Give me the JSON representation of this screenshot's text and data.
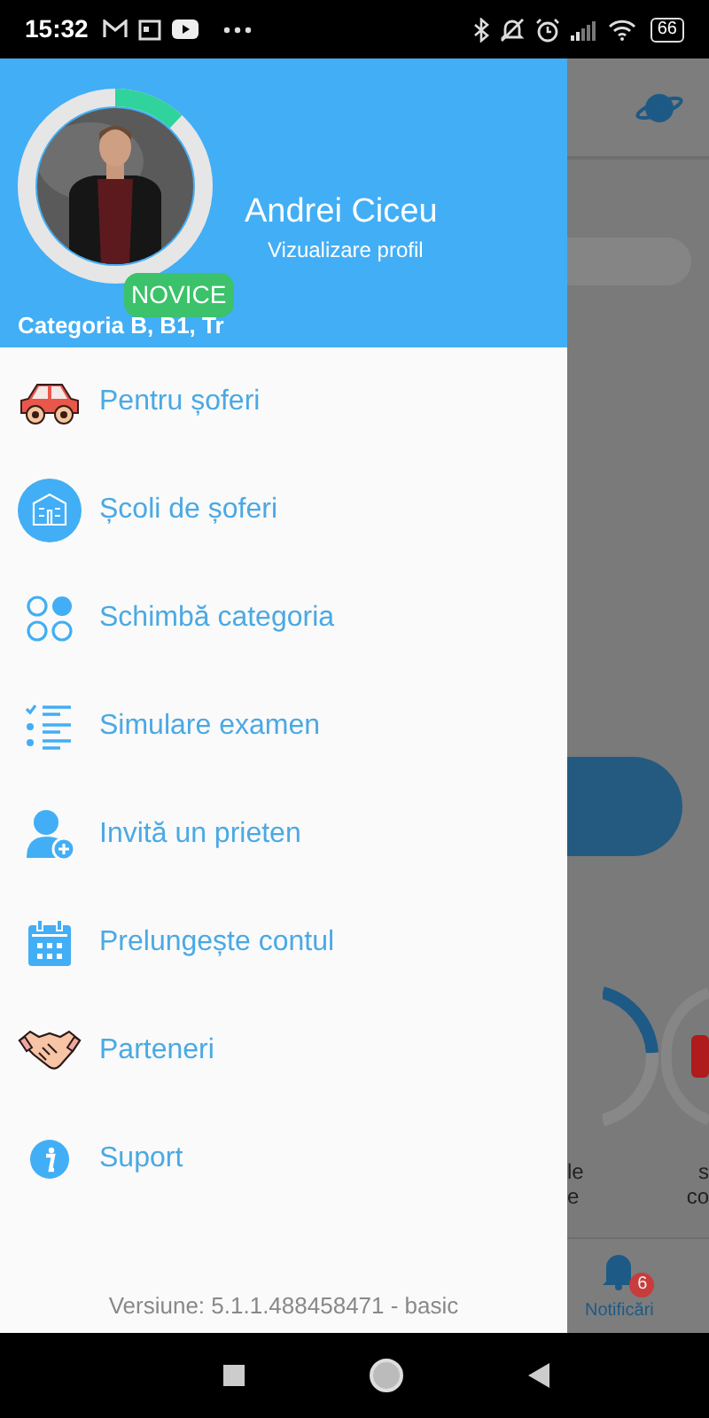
{
  "status_bar": {
    "time": "15:32",
    "battery": "66"
  },
  "profile": {
    "name": "Andrei Ciceu",
    "link": "Vizualizare profil",
    "badge": "NOVICE",
    "category": "Categoria B, B1, Tr"
  },
  "menu": [
    {
      "label": "Pentru șoferi",
      "kind": "car"
    },
    {
      "label": "Școli de șoferi",
      "kind": "school"
    },
    {
      "label": "Schimbă categoria",
      "kind": "dots"
    },
    {
      "label": "Simulare examen",
      "kind": "checklist"
    },
    {
      "label": "Invită un prieten",
      "kind": "user-add"
    },
    {
      "label": "Prelungește contul",
      "kind": "calendar"
    },
    {
      "label": "Parteneri",
      "kind": "handshake"
    },
    {
      "label": "Suport",
      "kind": "info"
    }
  ],
  "version": "Versiune: 5.1.1.488458471 - basic",
  "background": {
    "card_texts": [
      "le",
      "e"
    ],
    "card2_texts": [
      "s",
      "co"
    ],
    "nav_label": "Notificări",
    "nav_badge": "6"
  }
}
